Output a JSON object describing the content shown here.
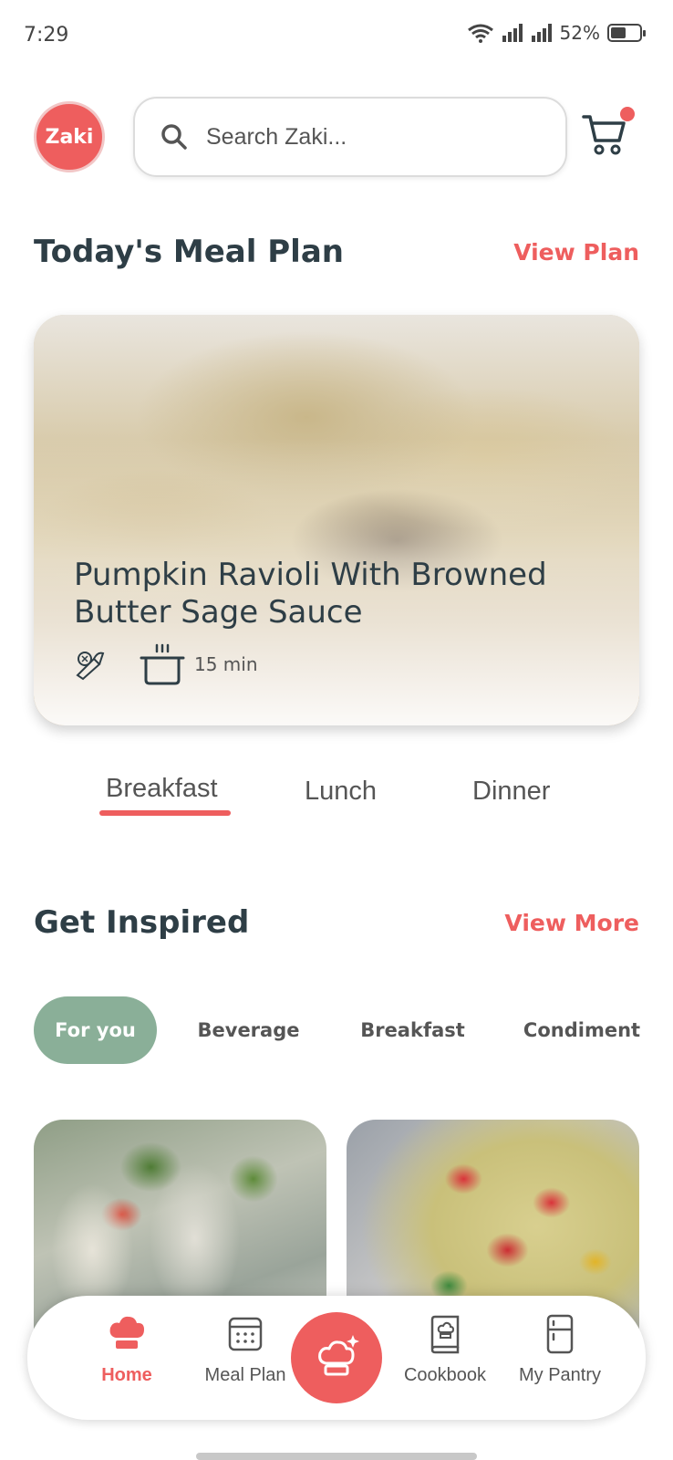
{
  "status_bar": {
    "time": "7:29",
    "battery": "52%",
    "battery_level": 0.52
  },
  "header": {
    "logo_text": "Zaki",
    "search_placeholder": "Search Zaki..."
  },
  "meal_plan": {
    "title": "Today's Meal Plan",
    "link": "View Plan",
    "featured": {
      "title": "Pumpkin Ravioli With Browned Butter Sage Sauce",
      "time": "15 min"
    },
    "tabs": [
      {
        "label": "Breakfast",
        "active": true
      },
      {
        "label": "Lunch",
        "active": false
      },
      {
        "label": "Dinner",
        "active": false
      }
    ]
  },
  "inspired": {
    "title": "Get Inspired",
    "link": "View More",
    "chips": [
      {
        "label": "For you",
        "active": true
      },
      {
        "label": "Beverage",
        "active": false
      },
      {
        "label": "Breakfast",
        "active": false
      },
      {
        "label": "Condiment",
        "active": false
      }
    ]
  },
  "bottom_nav": {
    "items": [
      {
        "label": "Home",
        "icon": "chef-hat-icon",
        "active": true
      },
      {
        "label": "Meal Plan",
        "icon": "calendar-icon",
        "active": false
      },
      {
        "label": "Cookbook",
        "icon": "cookbook-icon",
        "active": false
      },
      {
        "label": "My Pantry",
        "icon": "fridge-icon",
        "active": false
      }
    ],
    "fab_icon": "chef-hat-sparkle-icon"
  },
  "colors": {
    "accent": "#ee5e5e",
    "chip_active": "#8aaf98",
    "text_dark": "#2e3e46"
  }
}
